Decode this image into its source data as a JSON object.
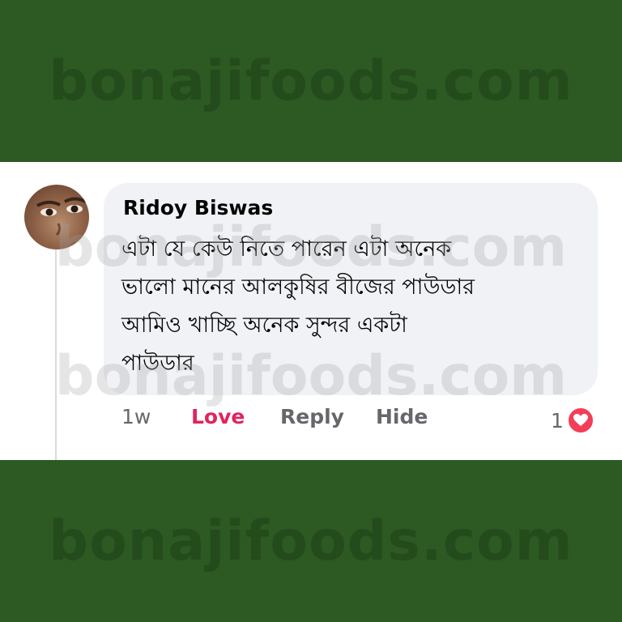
{
  "watermark": {
    "text": "bonajifoods.com"
  },
  "comment": {
    "author": "Ridoy Biswas",
    "lines": [
      "এটা যে কেউ নিতে পারেন এটা অনেক",
      "ভালো মানের আলকুষির বীজের পাউডার",
      "আমিও খাচ্ছি অনেক সুন্দর একটা",
      "পাউডার"
    ],
    "time": "1w",
    "love_label": "Love",
    "reply_label": "Reply",
    "hide_label": "Hide",
    "reaction_count": "1",
    "reaction_icon": "love-reaction-icon",
    "colors": {
      "love": "#e0245e",
      "bubble": "#f0f2f5",
      "background": "#2c5a22"
    }
  }
}
